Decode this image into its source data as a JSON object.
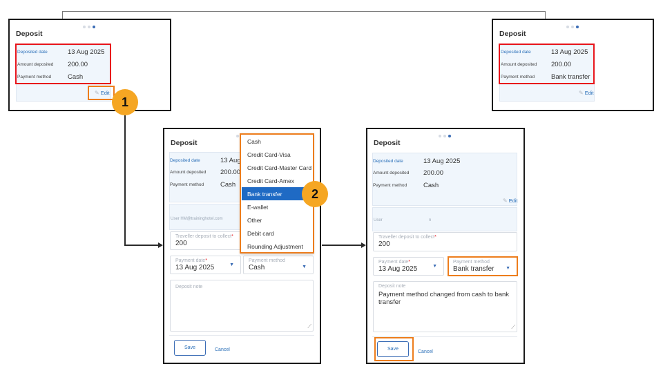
{
  "deposit_title": "Deposit",
  "labels": {
    "deposited_date": "Deposited date",
    "amount_deposited": "Amount deposited",
    "payment_method": "Payment method",
    "edit": "Edit"
  },
  "panel_before": {
    "deposited_date": "13 Aug 2025",
    "amount_deposited": "200.00",
    "payment_method": "Cash"
  },
  "panel_after": {
    "deposited_date": "13 Aug 2025",
    "amount_deposited": "200.00",
    "payment_method": "Bank transfer"
  },
  "edit_form_open": {
    "deposited_date": "13 Aug",
    "amount_deposited": "200.00",
    "payment_method": "Cash",
    "user_line": "User HM@traininghotel.com",
    "traveller_deposit_label": "Traveller deposit to collect",
    "traveller_deposit_value": "200",
    "payment_date_label": "Payment date",
    "payment_date_value": "13 Aug 2025",
    "payment_method_label": "Payment method",
    "payment_method_value": "Cash",
    "deposit_note_placeholder": "Deposit note",
    "save": "Save",
    "cancel": "Cancel"
  },
  "edit_form_filled": {
    "deposited_date": "13 Aug 2025",
    "amount_deposited": "200.00",
    "payment_method": "Cash",
    "edit": "Edit",
    "user_label": "User",
    "user_value": "n",
    "traveller_deposit_label": "Traveller deposit to collect",
    "traveller_deposit_value": "200",
    "payment_date_label": "Payment date",
    "payment_date_value": "13 Aug 2025",
    "payment_method_label": "Payment method",
    "payment_method_value": "Bank transfer",
    "deposit_note_label": "Deposit note",
    "deposit_note_value": "Payment method changed from cash to bank transfer",
    "save": "Save",
    "cancel": "Cancel"
  },
  "dropdown_options": [
    "Cash",
    "Credit Card-Visa",
    "Credit Card-Master Card",
    "Credit Card-Amex",
    "Bank transfer",
    "E-wallet",
    "Other",
    "Debit card",
    "Rounding Adjustment"
  ],
  "selected_option": "Bank transfer",
  "step_badges": [
    "1",
    "2"
  ],
  "required_mark": "*",
  "colors": {
    "highlight_red": "#e8141b",
    "highlight_orange": "#ed7d1c",
    "badge": "#f5a623",
    "accent_blue": "#2a6fb8",
    "selected_blue": "#1f6ac4"
  }
}
